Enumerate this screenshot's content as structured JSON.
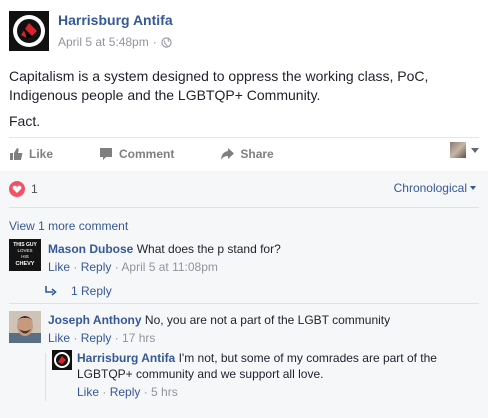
{
  "post": {
    "page_name": "Harrisburg Antifa",
    "timestamp": "April 5 at 5:48pm",
    "separator": "·",
    "paragraphs": [
      "Capitalism is a system designed to oppress the working class, PoC, Indigenous people and the LGBTQP+ Community.",
      "Fact."
    ],
    "actions": {
      "like": "Like",
      "comment": "Comment",
      "share": "Share"
    }
  },
  "reactions": {
    "count": "1",
    "order_label": "Chronological"
  },
  "view_more": "View 1 more comment",
  "comments": [
    {
      "author": "Mason Dubose",
      "text": "What does the p stand for?",
      "like": "Like",
      "reply": "Reply",
      "time": "April 5 at 11:08pm",
      "reply_count": "1 Reply"
    },
    {
      "author": "Joseph Anthony",
      "text": "No, you are not a part of the LGBT community",
      "like": "Like",
      "reply": "Reply",
      "time": "17 hrs"
    }
  ],
  "reply": {
    "author": "Harrisburg Antifa",
    "text": "I'm not, but some of my comrades are part of the LGBTQP+ community and we support all love.",
    "like": "Like",
    "reply": "Reply",
    "time": "5 hrs"
  },
  "colors": {
    "link": "#365899",
    "meta": "#90949c",
    "heart": "#f25268",
    "flag_red": "#d8232a"
  },
  "icons": [
    "antifa-logo-icon",
    "globe-icon",
    "like-icon",
    "comment-icon",
    "share-icon",
    "heart-icon",
    "reply-arrow-icon"
  ],
  "avatar_texts": {
    "mason": [
      "THIS GUY",
      "LOVES",
      "HIS",
      "CHEVY"
    ]
  }
}
